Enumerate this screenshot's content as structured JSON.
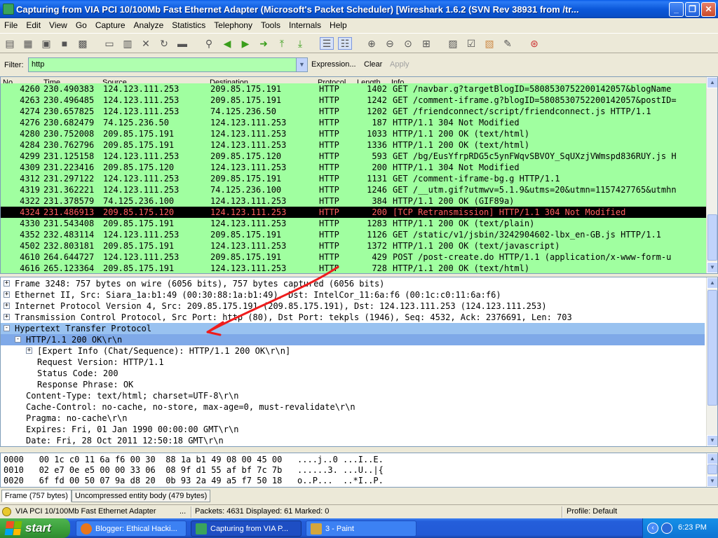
{
  "window": {
    "title": "Capturing from VIA PCI 10/100Mb Fast Ethernet Adapter          (Microsoft's Packet Scheduler)     [Wireshark 1.6.2  (SVN Rev 38931 from /tr..."
  },
  "menu": [
    "File",
    "Edit",
    "View",
    "Go",
    "Capture",
    "Analyze",
    "Statistics",
    "Telephony",
    "Tools",
    "Internals",
    "Help"
  ],
  "filter": {
    "label": "Filter:",
    "value": "http",
    "expression": "Expression...",
    "clear": "Clear",
    "apply": "Apply"
  },
  "packet_list": {
    "columns": [
      "No.",
      "Time",
      "Source",
      "Destination",
      "Protocol",
      "Length",
      "Info"
    ],
    "rows": [
      {
        "no": "4260",
        "time": "230.490383",
        "src": "124.123.111.253",
        "dst": "209.85.175.191",
        "proto": "HTTP",
        "len": "1402",
        "info": "GET /navbar.g?targetBlogID=5808530752200142057&blogName"
      },
      {
        "no": "4263",
        "time": "230.496485",
        "src": "124.123.111.253",
        "dst": "209.85.175.191",
        "proto": "HTTP",
        "len": "1242",
        "info": "GET /comment-iframe.g?blogID=5808530752200142057&postID="
      },
      {
        "no": "4274",
        "time": "230.657825",
        "src": "124.123.111.253",
        "dst": "74.125.236.50",
        "proto": "HTTP",
        "len": "1202",
        "info": "GET /friendconnect/script/friendconnect.js HTTP/1.1"
      },
      {
        "no": "4276",
        "time": "230.682479",
        "src": "74.125.236.50",
        "dst": "124.123.111.253",
        "proto": "HTTP",
        "len": "187",
        "info": "HTTP/1.1 304 Not Modified"
      },
      {
        "no": "4280",
        "time": "230.752008",
        "src": "209.85.175.191",
        "dst": "124.123.111.253",
        "proto": "HTTP",
        "len": "1033",
        "info": "HTTP/1.1 200 OK  (text/html)"
      },
      {
        "no": "4284",
        "time": "230.762796",
        "src": "209.85.175.191",
        "dst": "124.123.111.253",
        "proto": "HTTP",
        "len": "1336",
        "info": "HTTP/1.1 200 OK  (text/html)"
      },
      {
        "no": "4299",
        "time": "231.125158",
        "src": "124.123.111.253",
        "dst": "209.85.175.120",
        "proto": "HTTP",
        "len": "593",
        "info": "GET /bg/EusYfrpRDG5c5ynFWqvSBVOY_SqUXzjVWmspd836RUY.js H"
      },
      {
        "no": "4309",
        "time": "231.223416",
        "src": "209.85.175.120",
        "dst": "124.123.111.253",
        "proto": "HTTP",
        "len": "200",
        "info": "HTTP/1.1 304 Not Modified"
      },
      {
        "no": "4312",
        "time": "231.297122",
        "src": "124.123.111.253",
        "dst": "209.85.175.191",
        "proto": "HTTP",
        "len": "1131",
        "info": "GET /comment-iframe-bg.g HTTP/1.1"
      },
      {
        "no": "4319",
        "time": "231.362221",
        "src": "124.123.111.253",
        "dst": "74.125.236.100",
        "proto": "HTTP",
        "len": "1246",
        "info": "GET /__utm.gif?utmwv=5.1.9&utms=20&utmn=1157427765&utmhn"
      },
      {
        "no": "4322",
        "time": "231.378579",
        "src": "74.125.236.100",
        "dst": "124.123.111.253",
        "proto": "HTTP",
        "len": "384",
        "info": "HTTP/1.1 200 OK  (GIF89a)"
      },
      {
        "no": "4324",
        "time": "231.486913",
        "src": "209.85.175.120",
        "dst": "124.123.111.253",
        "proto": "HTTP",
        "len": "200",
        "info": "[TCP Retransmission] HTTP/1.1 304 Not Modified"
      },
      {
        "no": "4330",
        "time": "231.543408",
        "src": "209.85.175.191",
        "dst": "124.123.111.253",
        "proto": "HTTP",
        "len": "1283",
        "info": "HTTP/1.1 200 OK  (text/plain)"
      },
      {
        "no": "4352",
        "time": "232.483114",
        "src": "124.123.111.253",
        "dst": "209.85.175.191",
        "proto": "HTTP",
        "len": "1126",
        "info": "GET /static/v1/jsbin/3242904602-lbx_en-GB.js HTTP/1.1"
      },
      {
        "no": "4502",
        "time": "232.803181",
        "src": "209.85.175.191",
        "dst": "124.123.111.253",
        "proto": "HTTP",
        "len": "1372",
        "info": "HTTP/1.1 200 OK  (text/javascript)"
      },
      {
        "no": "4610",
        "time": "264.644727",
        "src": "124.123.111.253",
        "dst": "209.85.175.191",
        "proto": "HTTP",
        "len": "429",
        "info": "POST /post-create.do HTTP/1.1  (application/x-www-form-u"
      },
      {
        "no": "4616",
        "time": "265.123364",
        "src": "209.85.175.191",
        "dst": "124.123.111.253",
        "proto": "HTTP",
        "len": "728",
        "info": "HTTP/1.1 200 OK  (text/html)"
      }
    ]
  },
  "details": [
    {
      "exp": "+",
      "text": "Frame 3248: 757 bytes on wire (6056 bits), 757 bytes captured (6056 bits)"
    },
    {
      "exp": "+",
      "text": "Ethernet II, Src: Siara_1a:b1:49 (00:30:88:1a:b1:49), Dst: IntelCor_11:6a:f6 (00:1c:c0:11:6a:f6)"
    },
    {
      "exp": "+",
      "text": "Internet Protocol Version 4, Src: 209.85.175.191 (209.85.175.191), Dst: 124.123.111.253 (124.123.111.253)"
    },
    {
      "exp": "+",
      "text": "Transmission Control Protocol, Src Port: http (80), Dst Port: tekpls (1946), Seq: 4532, Ack: 2376691, Len: 703"
    },
    {
      "exp": "-",
      "text": "Hypertext Transfer Protocol"
    },
    {
      "exp": "-",
      "text": "HTTP/1.1 200 OK\\r\\n"
    },
    {
      "exp": "+",
      "text": "[Expert Info (Chat/Sequence): HTTP/1.1 200 OK\\r\\n]"
    },
    {
      "exp": "",
      "text": "Request Version: HTTP/1.1"
    },
    {
      "exp": "",
      "text": "Status Code: 200"
    },
    {
      "exp": "",
      "text": "Response Phrase: OK"
    },
    {
      "exp": "",
      "text": "Content-Type: text/html; charset=UTF-8\\r\\n"
    },
    {
      "exp": "",
      "text": "Cache-Control: no-cache, no-store, max-age=0, must-revalidate\\r\\n"
    },
    {
      "exp": "",
      "text": "Pragma: no-cache\\r\\n"
    },
    {
      "exp": "",
      "text": "Expires: Fri, 01 Jan 1990 00:00:00 GMT\\r\\n"
    },
    {
      "exp": "",
      "text": "Date: Fri, 28 Oct 2011 12:50:18 GMT\\r\\n"
    }
  ],
  "bytes": [
    "0000   00 1c c0 11 6a f6 00 30  88 1a b1 49 08 00 45 00   ....j..0 ...I..E.",
    "0010   02 e7 0e e5 00 00 33 06  08 9f d1 55 af bf 7c 7b   ......3. ...U..|{",
    "0020   6f fd 00 50 07 9a d8 20  0b 93 2a 49 a5 f7 50 18   o..P...  ..*I..P."
  ],
  "tabs": [
    "Frame (757 bytes)",
    "Uncompressed entity body (479 bytes)"
  ],
  "status": {
    "interface": "VIA PCI 10/100Mb Fast Ethernet Adapter",
    "ellipsis": "...",
    "packets": "Packets: 4631 Displayed: 61 Marked: 0",
    "profile": "Profile: Default"
  },
  "taskbar": {
    "start": "start",
    "items": [
      "Blogger: Ethical Hacki...",
      "Capturing from VIA P...",
      "3 - Paint"
    ],
    "clock": "6:23 PM"
  },
  "colors": {
    "http_row": "#a0ffa0",
    "selected_row_bg": "#000000",
    "selected_row_fg": "#ff5f5f",
    "filter_valid": "#afffaf",
    "annotation_arrow": "#ee1c1c"
  },
  "icons": {
    "toolbar": [
      "interfaces-icon",
      "options-icon",
      "start-capture-icon",
      "stop-capture-icon",
      "restart-capture-icon",
      "open-icon",
      "save-icon",
      "close-file-icon",
      "reload-icon",
      "print-icon",
      "find-icon",
      "back-icon",
      "forward-icon",
      "go-to-icon",
      "first-packet-icon",
      "last-packet-icon",
      "colorize-icon",
      "autoscroll-icon",
      "zoom-in-icon",
      "zoom-out-icon",
      "normal-size-icon",
      "resize-columns-icon",
      "capture-filters-icon",
      "display-filters-icon",
      "coloring-rules-icon",
      "preferences-icon",
      "help-icon"
    ]
  }
}
